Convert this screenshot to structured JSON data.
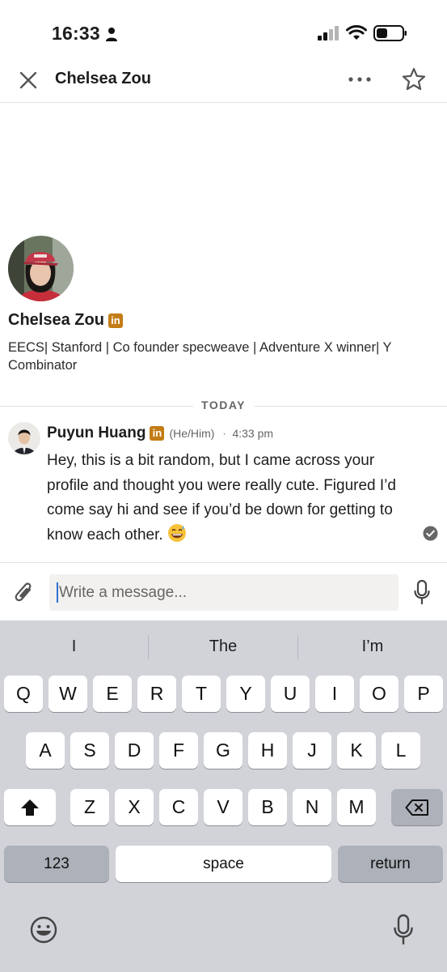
{
  "status_bar": {
    "time": "16:33"
  },
  "header": {
    "title": "Chelsea Zou"
  },
  "profile": {
    "name": "Chelsea Zou",
    "badge": "in",
    "headline": "EECS| Stanford | Co founder specweave | Adventure X winner| Y Combinator"
  },
  "conversation": {
    "divider": "TODAY",
    "messages": [
      {
        "sender": "Puyun Huang",
        "badge": "in",
        "pronouns": "(He/Him)",
        "separator": "·",
        "time": "4:33 pm",
        "text": "Hey, this is a bit random, but I came across your profile and thought you were really cute. Figured I’d come say hi and see if you’d be down for getting to know each other.",
        "emoji": "grinning-face-with-sweat"
      }
    ]
  },
  "composer": {
    "placeholder": "Write a message..."
  },
  "keyboard": {
    "suggestions": [
      "I",
      "The",
      "I’m"
    ],
    "row1": [
      "Q",
      "W",
      "E",
      "R",
      "T",
      "Y",
      "U",
      "I",
      "O",
      "P"
    ],
    "row2": [
      "A",
      "S",
      "D",
      "F",
      "G",
      "H",
      "J",
      "K",
      "L"
    ],
    "row3": [
      "Z",
      "X",
      "C",
      "V",
      "B",
      "N",
      "M"
    ],
    "numbers_label": "123",
    "space_label": "space",
    "return_label": "return"
  },
  "icons": {
    "close": "close-icon",
    "more": "more-horizontal-icon",
    "star": "star-icon",
    "attach": "paperclip-icon",
    "mic": "microphone-icon",
    "shift": "shift-icon",
    "delete": "backspace-icon",
    "emoji": "emoji-icon",
    "dictation": "dictation-icon"
  },
  "colors": {
    "badge": "#c37d16",
    "keyboard_bg": "#d1d3d9",
    "caret": "#2f6fd1"
  }
}
